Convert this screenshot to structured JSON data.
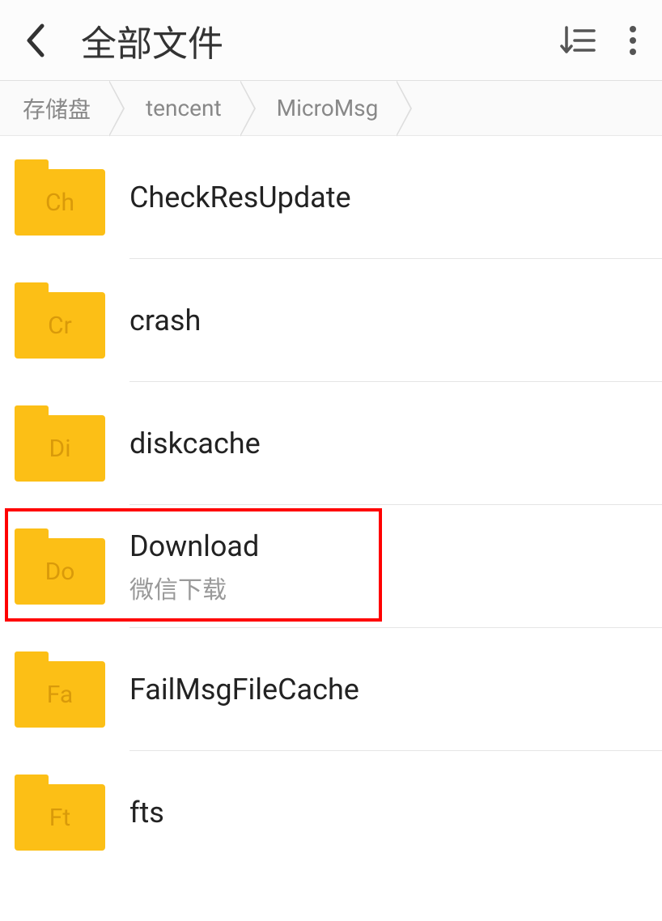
{
  "header": {
    "title": "全部文件"
  },
  "breadcrumb": {
    "items": [
      {
        "label": "存储盘"
      },
      {
        "label": "tencent"
      },
      {
        "label": "MicroMsg"
      }
    ]
  },
  "files": [
    {
      "iconLabel": "Ch",
      "name": "CheckResUpdate",
      "subtitle": ""
    },
    {
      "iconLabel": "Cr",
      "name": "crash",
      "subtitle": ""
    },
    {
      "iconLabel": "Di",
      "name": "diskcache",
      "subtitle": ""
    },
    {
      "iconLabel": "Do",
      "name": "Download",
      "subtitle": "微信下载",
      "highlighted": true
    },
    {
      "iconLabel": "Fa",
      "name": "FailMsgFileCache",
      "subtitle": ""
    },
    {
      "iconLabel": "Ft",
      "name": "fts",
      "subtitle": ""
    }
  ]
}
